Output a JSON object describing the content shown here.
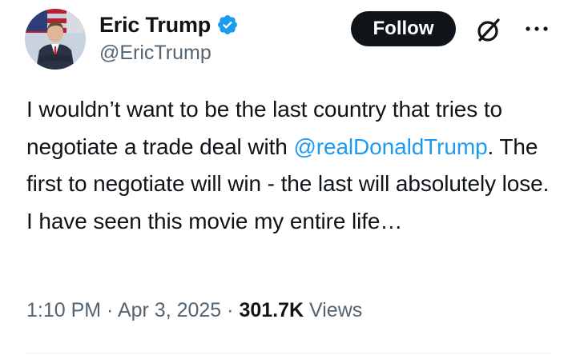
{
  "author": {
    "display_name": "Eric Trump",
    "handle": "@EricTrump",
    "verified": true,
    "verified_color": "#1d9bf0"
  },
  "actions": {
    "follow_label": "Follow",
    "grok_icon": "grok-icon",
    "more_icon": "more-dots-icon"
  },
  "tweet": {
    "text_before": "I wouldn’t want to be the last country that tries to negotiate a trade deal with ",
    "mention": "@realDonaldTrump",
    "text_after": ". The first to negotiate will win - the last will absolutely lose. I have seen this movie my entire life…"
  },
  "meta": {
    "time": "1:10 PM",
    "date": "Apr 3, 2025",
    "separator": " · ",
    "views_count": "301.7K",
    "views_label": "Views"
  },
  "colors": {
    "text_primary": "#0f1419",
    "text_secondary": "#536471",
    "link": "#1d9bf0",
    "follow_bg": "#0f1419"
  }
}
